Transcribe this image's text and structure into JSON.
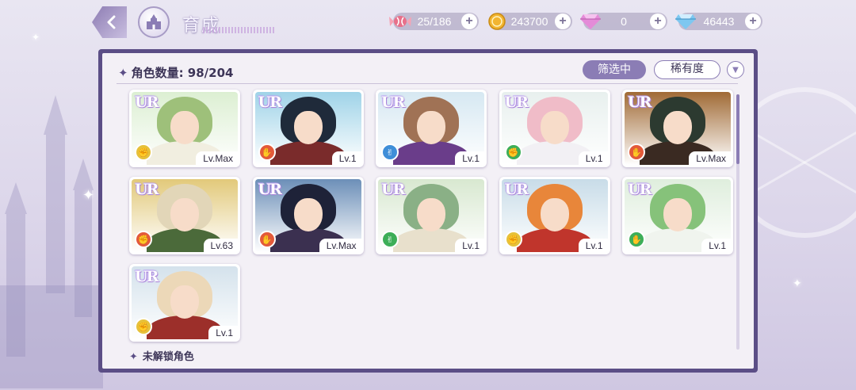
{
  "header": {
    "title": "育成"
  },
  "resources": [
    {
      "name": "candy",
      "icon": "candy-icon",
      "value": "25/186",
      "color": "#e8708a"
    },
    {
      "name": "gold",
      "icon": "gold-coin-icon",
      "value": "243700",
      "color": "#f2b531"
    },
    {
      "name": "paid-diamond",
      "icon": "pink-diamond-icon",
      "value": "0",
      "color": "#e48bd8"
    },
    {
      "name": "diamond",
      "icon": "blue-diamond-icon",
      "value": "46443",
      "color": "#7ec7f0"
    }
  ],
  "panel": {
    "count_label": "角色数量: 98/204",
    "filter_label": "筛选中",
    "rarity_label": "稀有度",
    "locked_label": "未解锁角色"
  },
  "cards": [
    {
      "rarity": "UR",
      "level": "Lv.Max",
      "attr_color": "#e6c13a",
      "hair": "#9ec07a",
      "sky": "#dcefd2",
      "outfit": "#f1eee0"
    },
    {
      "rarity": "UR",
      "level": "Lv.1",
      "attr_color": "#e35a3a",
      "hair": "#1f2a3a",
      "sky": "#9fd3e8",
      "outfit": "#7a2b2b"
    },
    {
      "rarity": "UR",
      "level": "Lv.1",
      "attr_color": "#3f8ed8",
      "hair": "#a07255",
      "sky": "#d6e8f2",
      "outfit": "#6a3d8a"
    },
    {
      "rarity": "UR",
      "level": "Lv.1",
      "attr_color": "#3dae58",
      "hair": "#f0bcc8",
      "sky": "#e8f0ee",
      "outfit": "#f2f0f4"
    },
    {
      "rarity": "UR",
      "level": "Lv.Max",
      "attr_color": "#e35a3a",
      "hair": "#2c3a30",
      "sky": "#a06a35",
      "outfit": "#3a2a22"
    },
    {
      "rarity": "UR",
      "level": "Lv.63",
      "attr_color": "#e35a3a",
      "hair": "#e2d6b8",
      "sky": "#e2c97a",
      "outfit": "#4b6a3a"
    },
    {
      "rarity": "UR",
      "level": "Lv.Max",
      "attr_color": "#e35a3a",
      "hair": "#1e2238",
      "sky": "#6c8fb8",
      "outfit": "#3b3050"
    },
    {
      "rarity": "UR",
      "level": "Lv.1",
      "attr_color": "#3dae58",
      "hair": "#8ab086",
      "sky": "#d8e8d0",
      "outfit": "#e8e0cc"
    },
    {
      "rarity": "UR",
      "level": "Lv.1",
      "attr_color": "#e6c13a",
      "hair": "#e8863a",
      "sky": "#c8dce8",
      "outfit": "#c0352c"
    },
    {
      "rarity": "UR",
      "level": "Lv.1",
      "attr_color": "#3dae58",
      "hair": "#86c27a",
      "sky": "#dfeedd",
      "outfit": "#f0f4ee"
    },
    {
      "rarity": "UR",
      "level": "Lv.1",
      "attr_color": "#e6c13a",
      "hair": "#ecd8b8",
      "sky": "#d4e2ec",
      "outfit": "#9c2f2a"
    }
  ]
}
